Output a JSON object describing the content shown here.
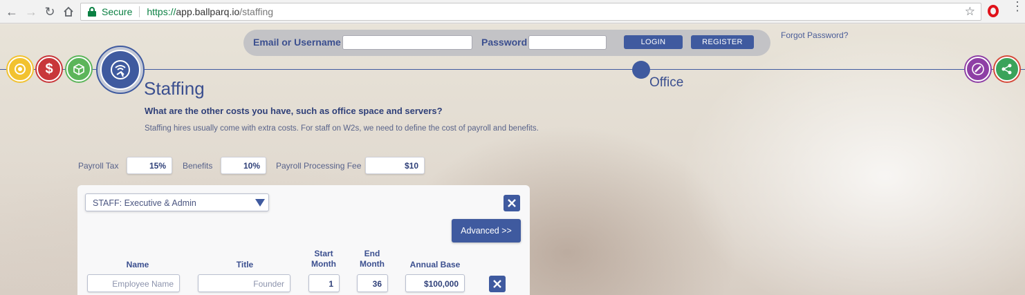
{
  "browser": {
    "secure_label": "Secure",
    "url_prefix": "https://",
    "url_host": "app.ballparq.io",
    "url_path": "/staffing"
  },
  "login": {
    "email_label": "Email or Username",
    "email_value": "",
    "password_label": "Password",
    "password_value": "",
    "login_button": "LOGIN",
    "register_button": "REGISTER",
    "forgot_link": "Forgot Password?"
  },
  "timeline": {
    "steps": [
      {
        "icon": "coins-icon",
        "color": "#f2c230"
      },
      {
        "icon": "dollar-icon",
        "color": "#c8363a"
      },
      {
        "icon": "box-icon",
        "color": "#5cb55a"
      },
      {
        "icon": "staffing-icon",
        "color": "#3f5a9f"
      },
      {
        "icon": "pencil-icon",
        "color": "#8e3fa5"
      },
      {
        "icon": "share-icon",
        "color": "#3aa35a"
      }
    ],
    "office_label": "Office"
  },
  "main": {
    "title": "Staffing",
    "question": "What are the other costs you have, such as office space and servers?",
    "description": "Staffing hires usually come with extra costs. For staff on W2s, we need to define the cost of payroll and benefits."
  },
  "fees": {
    "payroll_tax_label": "Payroll Tax",
    "payroll_tax_value": "15%",
    "benefits_label": "Benefits",
    "benefits_value": "10%",
    "processing_label": "Payroll Processing Fee",
    "processing_value": "$10"
  },
  "staff_panel": {
    "category_selected": "STAFF: Executive & Admin",
    "advanced_button": "Advanced >>",
    "columns": {
      "name": "Name",
      "title": "Title",
      "start_1": "Start",
      "start_2": "Month",
      "end_1": "End",
      "end_2": "Month",
      "annual_base": "Annual Base"
    },
    "rows": [
      {
        "name_placeholder": "Employee Name",
        "title": "Founder",
        "start_month": "1",
        "end_month": "36",
        "annual_base": "$100,000"
      }
    ]
  },
  "colors": {
    "accent": "#3f5a9f",
    "text_dark": "#2e3f78",
    "secure_green": "#0b8043"
  }
}
